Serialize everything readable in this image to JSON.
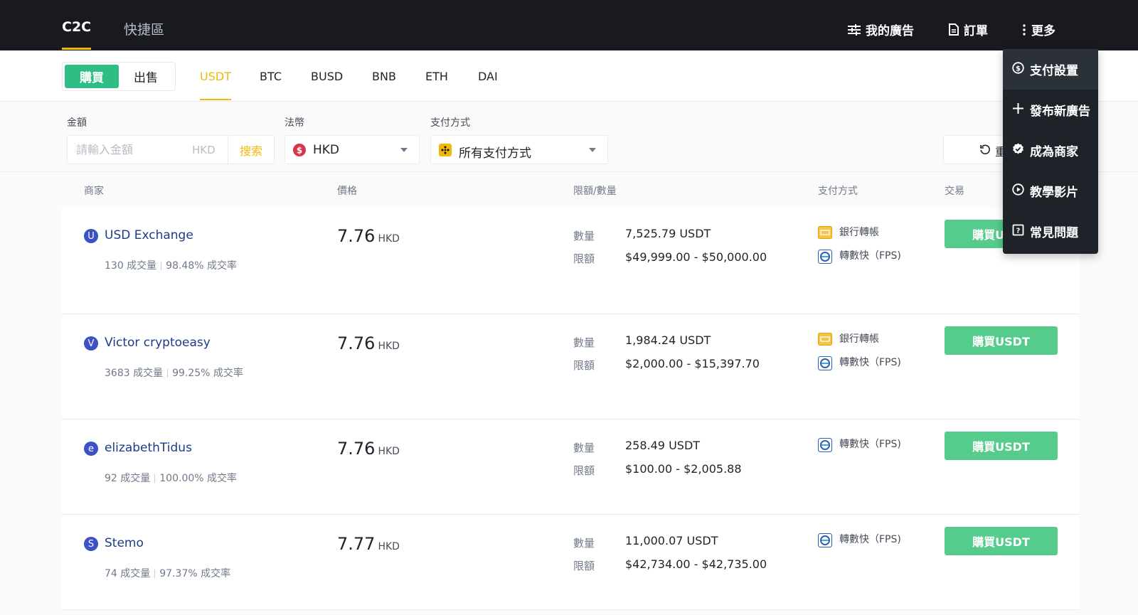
{
  "nav": {
    "tab_c2c": "C2C",
    "tab_quick": "快捷區",
    "my_ads": "我的廣告",
    "orders": "訂單",
    "more": "更多"
  },
  "trade_side": {
    "buy": "購買",
    "sell": "出售"
  },
  "coins": [
    "USDT",
    "BTC",
    "BUSD",
    "BNB",
    "ETH",
    "DAI"
  ],
  "active_coin": "USDT",
  "filters": {
    "amount_label": "金額",
    "amount_placeholder": "請輸入金額",
    "amount_currency": "HKD",
    "search_label": "搜索",
    "fiat_label": "法幣",
    "fiat_value": "HKD",
    "payment_label": "支付方式",
    "payment_value": "所有支付方式",
    "reset_label": "重"
  },
  "table_headers": {
    "merchant": "商家",
    "price": "價格",
    "limit_qty": "限額/數量",
    "payment": "支付方式",
    "trade": "交易"
  },
  "labels": {
    "qty": "數量",
    "limit": "限額",
    "orders_suffix": "成交量",
    "rate_suffix": "成交率"
  },
  "rows": [
    {
      "initial": "U",
      "name": "USD Exchange",
      "orders": "130 成交量",
      "rate": "98.48% 成交率",
      "price": "7.76",
      "price_currency": "HKD",
      "qty_label": "數量",
      "qty": "7,525.79 USDT",
      "limit_label": "限額",
      "limit": "$49,999.00 - $50,000.00",
      "payments": [
        "銀行轉帳",
        "轉數快（FPS)"
      ],
      "button": "購買USDT"
    },
    {
      "initial": "V",
      "name": "Victor cryptoeasy",
      "orders": "3683 成交量",
      "rate": "99.25% 成交率",
      "price": "7.76",
      "price_currency": "HKD",
      "qty_label": "數量",
      "qty": "1,984.24 USDT",
      "limit_label": "限額",
      "limit": "$2,000.00 - $15,397.70",
      "payments": [
        "銀行轉帳",
        "轉數快（FPS)"
      ],
      "button": "購買USDT"
    },
    {
      "initial": "e",
      "name": "elizabethTidus",
      "orders": "92 成交量",
      "rate": "100.00% 成交率",
      "price": "7.76",
      "price_currency": "HKD",
      "qty_label": "數量",
      "qty": "258.49 USDT",
      "limit_label": "限額",
      "limit": "$100.00 - $2,005.88",
      "payments": [
        "轉數快（FPS)"
      ],
      "button": "購買USDT"
    },
    {
      "initial": "S",
      "name": "Stemo",
      "orders": "74 成交量",
      "rate": "97.37% 成交率",
      "price": "7.77",
      "price_currency": "HKD",
      "qty_label": "數量",
      "qty": "11,000.07 USDT",
      "limit_label": "限額",
      "limit": "$42,734.00 - $42,735.00",
      "payments": [
        "轉數快（FPS)"
      ],
      "button": "購買USDT"
    }
  ],
  "more_menu": {
    "items": [
      {
        "label": "支付設置",
        "icon": "dollar-circle-icon"
      },
      {
        "label": "發布新廣告",
        "icon": "plus-icon"
      },
      {
        "label": "成為商家",
        "icon": "verified-badge-icon"
      },
      {
        "label": "教學影片",
        "icon": "play-circle-icon"
      },
      {
        "label": "常見問題",
        "icon": "question-icon"
      }
    ]
  },
  "colors": {
    "nav_bg": "#181a20",
    "accent": "#f0b90b",
    "buy_green": "#2ebd85",
    "button_green": "#55cc8c",
    "merchant_blue": "#1e3a8a"
  }
}
